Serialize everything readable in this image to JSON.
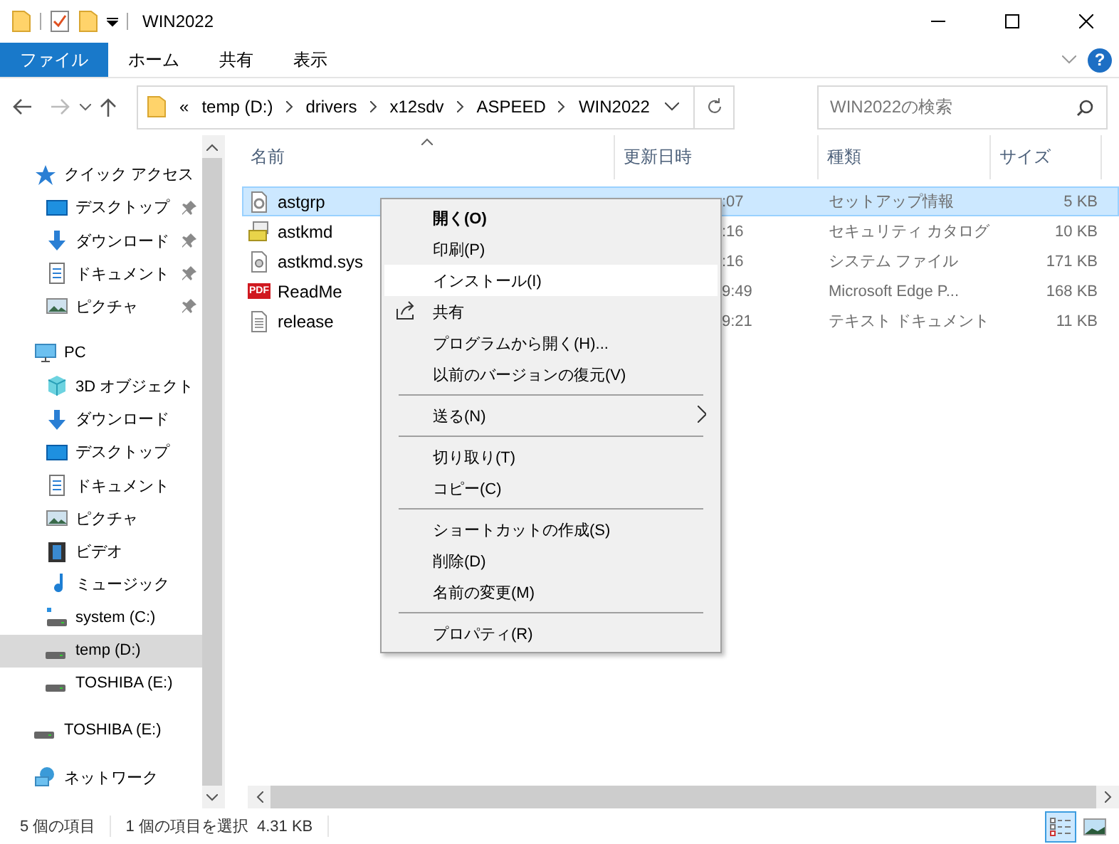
{
  "window": {
    "title": "WIN2022"
  },
  "ribbon": {
    "tabs": [
      {
        "label": "ファイル",
        "selected": true
      },
      {
        "label": "ホーム",
        "selected": false
      },
      {
        "label": "共有",
        "selected": false
      },
      {
        "label": "表示",
        "selected": false
      }
    ],
    "help": "?"
  },
  "address": {
    "overflow": "«",
    "path": [
      "temp (D:)",
      "drivers",
      "x12sdv",
      "ASPEED",
      "WIN2022"
    ]
  },
  "search": {
    "placeholder": "WIN2022の検索"
  },
  "sidebar": {
    "items": [
      {
        "label": "クイック アクセス",
        "kind": "star",
        "selected": false,
        "children": [
          {
            "label": "デスクトップ",
            "kind": "desktop",
            "pinned": true,
            "selected": false
          },
          {
            "label": "ダウンロード",
            "kind": "download",
            "pinned": true,
            "selected": false
          },
          {
            "label": "ドキュメント",
            "kind": "document",
            "pinned": true,
            "selected": false
          },
          {
            "label": "ピクチャ",
            "kind": "pictures",
            "pinned": true,
            "selected": false
          }
        ]
      },
      {
        "label": "PC",
        "kind": "pc",
        "selected": false,
        "children": [
          {
            "label": "3D オブジェクト",
            "kind": "cube",
            "selected": false
          },
          {
            "label": "ダウンロード",
            "kind": "download",
            "selected": false
          },
          {
            "label": "デスクトップ",
            "kind": "desktop",
            "selected": false
          },
          {
            "label": "ドキュメント",
            "kind": "document",
            "selected": false
          },
          {
            "label": "ピクチャ",
            "kind": "pictures",
            "selected": false
          },
          {
            "label": "ビデオ",
            "kind": "video",
            "selected": false
          },
          {
            "label": "ミュージック",
            "kind": "music",
            "selected": false
          },
          {
            "label": "system (C:)",
            "kind": "sysdrive",
            "selected": false
          },
          {
            "label": "temp (D:)",
            "kind": "drive",
            "selected": true
          },
          {
            "label": "TOSHIBA (E:)",
            "kind": "drive",
            "selected": false
          }
        ]
      },
      {
        "label": "TOSHIBA (E:)",
        "kind": "drive",
        "selected": false
      },
      {
        "label": "ネットワーク",
        "kind": "network",
        "selected": false
      }
    ]
  },
  "table": {
    "columns": [
      "名前",
      "更新日時",
      "種類",
      "サイズ"
    ],
    "rows": [
      {
        "name": "astgrp",
        "kind": "setup",
        "date": ":07",
        "type": "セットアップ情報",
        "size": "5 KB",
        "selected": true
      },
      {
        "name": "astkmd",
        "kind": "catalog",
        "date": ":16",
        "type": "セキュリティ カタログ",
        "size": "10 KB",
        "selected": false
      },
      {
        "name": "astkmd.sys",
        "kind": "sys",
        "date": ":16",
        "type": "システム ファイル",
        "size": "171 KB",
        "selected": false
      },
      {
        "name": "ReadMe",
        "kind": "pdf",
        "pdf_label": "PDF",
        "date": "9:49",
        "type": "Microsoft Edge P...",
        "size": "168 KB",
        "selected": false
      },
      {
        "name": "release",
        "kind": "text",
        "date": "9:21",
        "type": "テキスト ドキュメント",
        "size": "11 KB",
        "selected": false
      }
    ]
  },
  "context_menu": {
    "items": [
      {
        "kind": "item",
        "label": "開く(O)",
        "default": true,
        "selected": false
      },
      {
        "kind": "item",
        "label": "印刷(P)",
        "default": false,
        "selected": false
      },
      {
        "kind": "item",
        "label": "インストール(I)",
        "default": false,
        "selected": true
      },
      {
        "kind": "icon_item",
        "label": "共有",
        "default": false,
        "selected": false
      },
      {
        "kind": "item",
        "label": "プログラムから開く(H)...",
        "default": false,
        "selected": false
      },
      {
        "kind": "item",
        "label": "以前のバージョンの復元(V)",
        "default": false,
        "selected": false
      },
      {
        "kind": "separator"
      },
      {
        "kind": "item",
        "label": "送る(N)",
        "default": false,
        "selected": false,
        "submenu": true
      },
      {
        "kind": "separator"
      },
      {
        "kind": "item",
        "label": "切り取り(T)",
        "default": false,
        "selected": false
      },
      {
        "kind": "item",
        "label": "コピー(C)",
        "default": false,
        "selected": false
      },
      {
        "kind": "separator"
      },
      {
        "kind": "item",
        "label": "ショートカットの作成(S)",
        "default": false,
        "selected": false
      },
      {
        "kind": "item",
        "label": "削除(D)",
        "default": false,
        "selected": false
      },
      {
        "kind": "item",
        "label": "名前の変更(M)",
        "default": false,
        "selected": false
      },
      {
        "kind": "separator"
      },
      {
        "kind": "item",
        "label": "プロパティ(R)",
        "default": false,
        "selected": false
      }
    ]
  },
  "status_bar": {
    "count": "5 個の項目",
    "selection": "1 個の項目を選択  4.31 KB",
    "view": [
      {
        "kind": "details",
        "selected": true
      },
      {
        "kind": "thumbnails",
        "selected": false
      }
    ]
  }
}
